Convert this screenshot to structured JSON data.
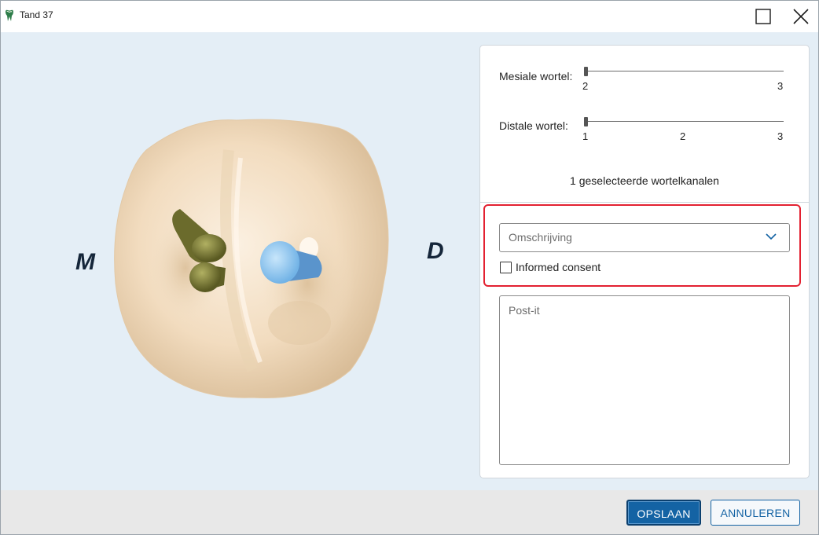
{
  "window": {
    "title": "Tand 37"
  },
  "viewer": {
    "label_mesial": "M",
    "label_distal": "D",
    "colors": {
      "background": "#e4eef6",
      "tooth": "#f2dcbf",
      "selected_canal": "#8fc7f0",
      "unselected_canal": "#7a7a36"
    }
  },
  "panel": {
    "mesial": {
      "label": "Mesiale wortel:",
      "ticks": [
        "2",
        "3"
      ],
      "value": "2"
    },
    "distal": {
      "label": "Distale wortel:",
      "ticks": [
        "1",
        "2",
        "3"
      ],
      "value": "1"
    },
    "selected_count_text": "1 geselecteerde wortelkanalen",
    "description_placeholder": "Omschrijving",
    "informed_consent_label": "Informed consent",
    "informed_consent_checked": false,
    "postit_placeholder": "Post-it"
  },
  "footer": {
    "save_label": "OPSLAAN",
    "cancel_label": "ANNULEREN"
  },
  "colors": {
    "accent": "#1463a4",
    "highlight": "#e32131"
  }
}
